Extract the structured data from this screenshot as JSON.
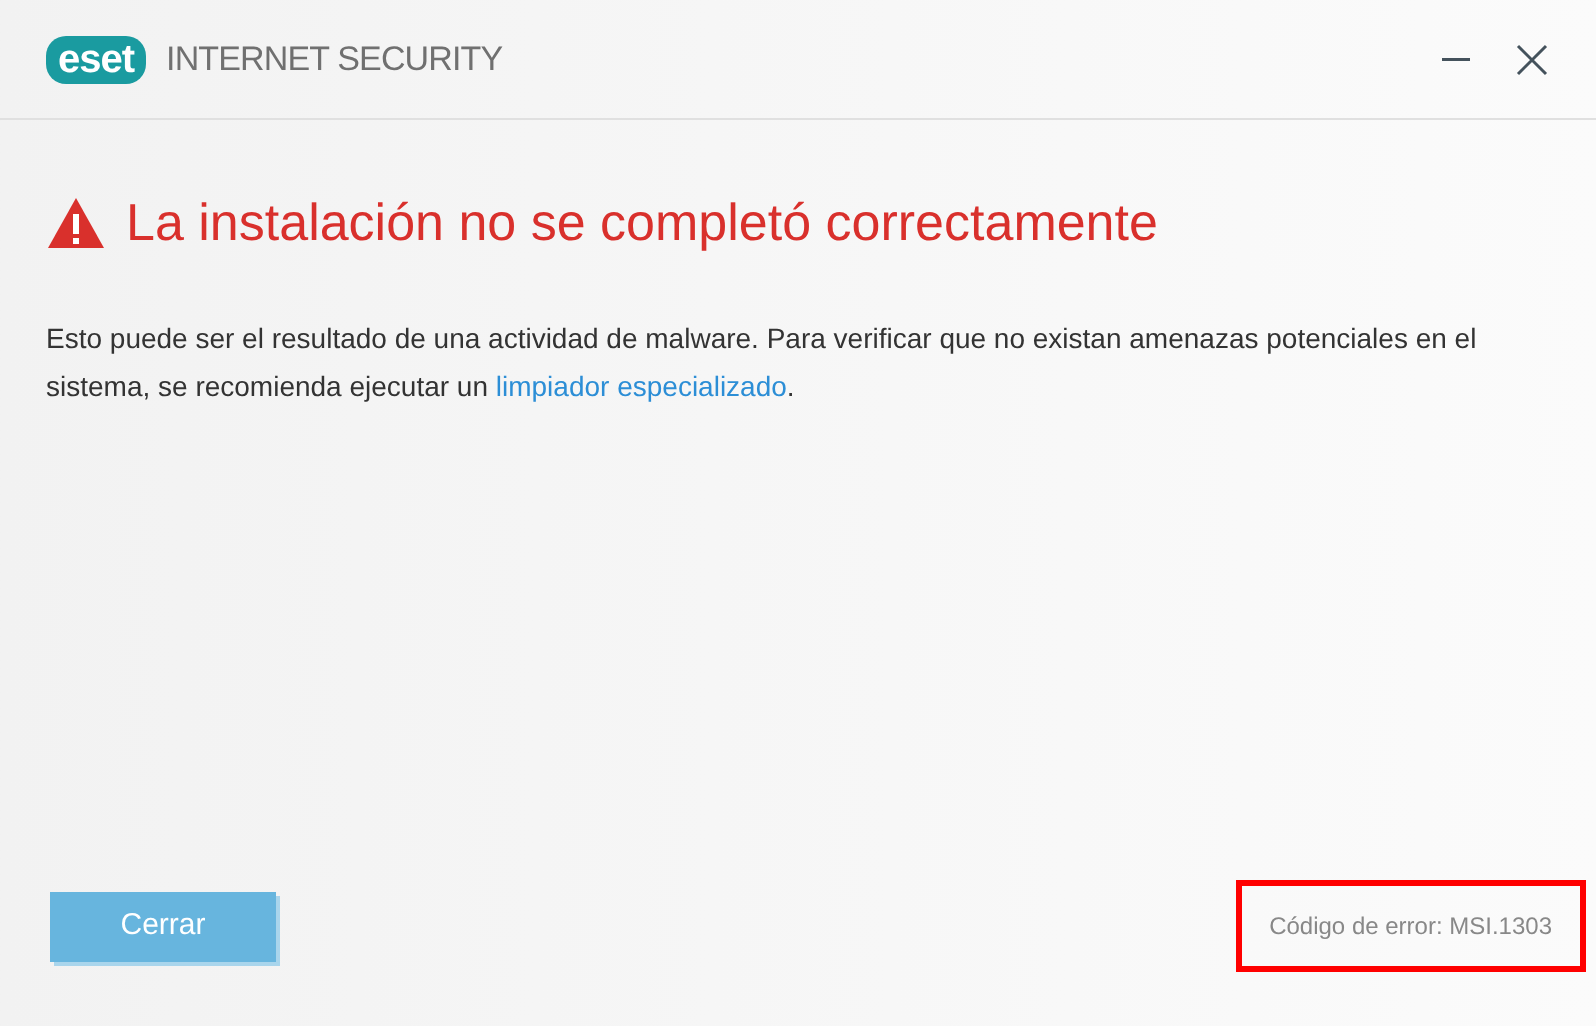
{
  "window": {
    "logo": "eset",
    "product": "INTERNET SECURITY"
  },
  "heading": "La instalación no se completó correctamente",
  "message": {
    "text": "Esto puede ser el resultado de una actividad de malware. Para verificar que no existan amenazas potenciales en el sistema, se recomienda ejecutar un ",
    "link": "limpiador especializado",
    "after": "."
  },
  "button": "Cerrar",
  "error_code": {
    "text": "Código de error: MSI.1303",
    "highlighted": true
  }
}
